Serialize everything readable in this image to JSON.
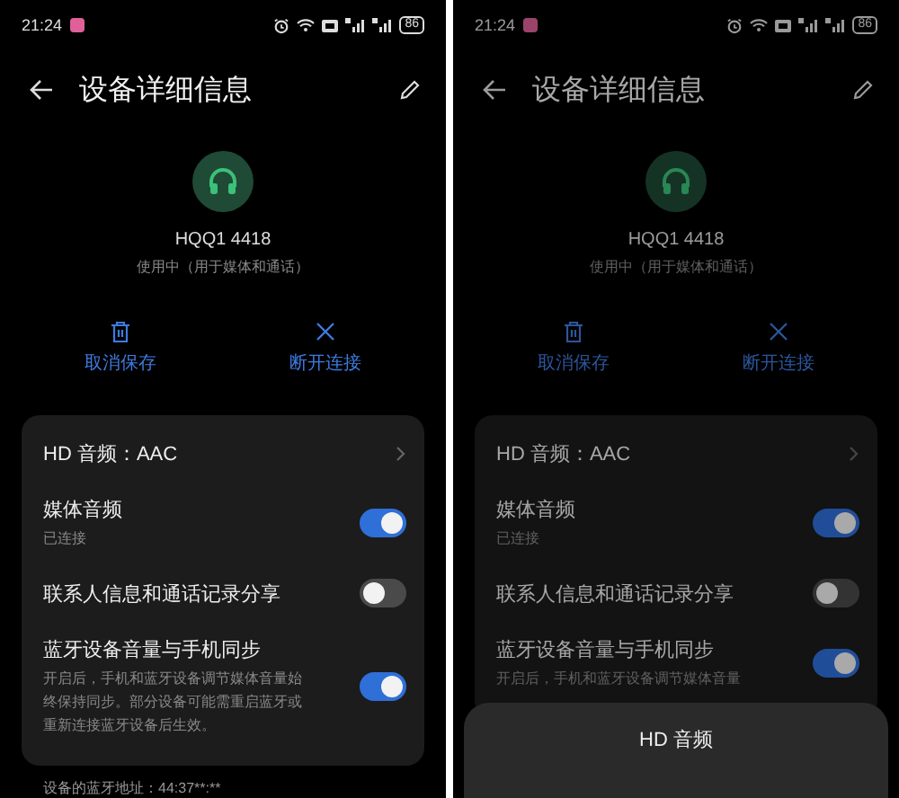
{
  "screens": [
    {
      "status_bar": {
        "time": "21:24",
        "battery": "86"
      },
      "title": "设备详细信息",
      "device": {
        "name": "HQQ1 4418",
        "status": "使用中（用于媒体和通话）"
      },
      "actions": [
        {
          "kind": "delete",
          "label": "取消保存"
        },
        {
          "kind": "disconnect",
          "label": "断开连接"
        }
      ],
      "settings": [
        {
          "kind": "link",
          "label": "HD 音频：AAC"
        },
        {
          "kind": "toggle",
          "label": "媒体音频",
          "description": "已连接",
          "on": true
        },
        {
          "kind": "toggle",
          "label": "联系人信息和通话记录分享",
          "on": false
        },
        {
          "kind": "toggle",
          "label": "蓝牙设备音量与手机同步",
          "description": "开启后，手机和蓝牙设备调节媒体音量始终保持同步。部分设备可能需重启蓝牙或重新连接蓝牙设备后生效。",
          "on": true
        }
      ],
      "address": "设备的蓝牙地址：44:37**:**"
    },
    {
      "status_bar": {
        "time": "21:24",
        "battery": "86"
      },
      "title": "设备详细信息",
      "device": {
        "name": "HQQ1 4418",
        "status": "使用中（用于媒体和通话）"
      },
      "actions": [
        {
          "kind": "delete",
          "label": "取消保存"
        },
        {
          "kind": "disconnect",
          "label": "断开连接"
        }
      ],
      "settings": [
        {
          "kind": "link",
          "label": "HD 音频：AAC"
        },
        {
          "kind": "toggle",
          "label": "媒体音频",
          "description": "已连接",
          "on": true
        },
        {
          "kind": "toggle",
          "label": "联系人信息和通话记录分享",
          "on": false
        },
        {
          "kind": "toggle",
          "label": "蓝牙设备音量与手机同步",
          "description": "开启后，手机和蓝牙设备调节媒体音量",
          "on": true
        }
      ],
      "sheet": {
        "title": "HD 音频"
      }
    }
  ]
}
